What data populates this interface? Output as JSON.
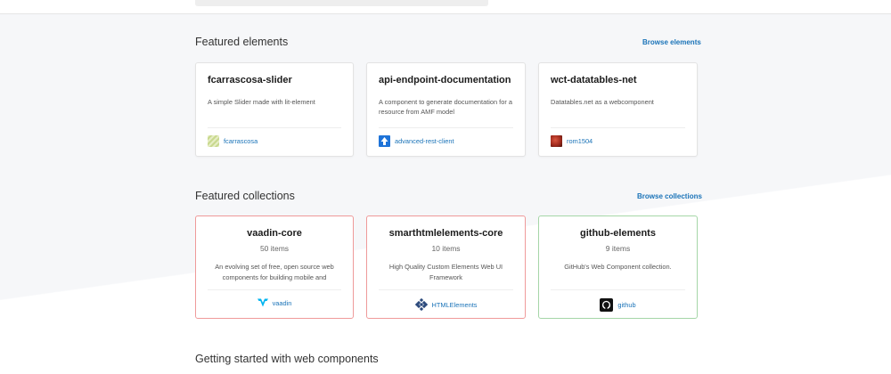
{
  "featured_elements": {
    "title": "Featured elements",
    "browse_label": "Browse elements",
    "cards": [
      {
        "name": "fcarrascosa-slider",
        "description": "A simple Slider made with lit-element",
        "owner": "fcarrascosa",
        "avatar_color": "#c9d98f"
      },
      {
        "name": "api-endpoint-documentation",
        "description": "A component to generate documentation for a resource from AMF model",
        "owner": "advanced-rest-client",
        "avatar_color": "#1e73d8"
      },
      {
        "name": "wct-datatables-net",
        "description": "Datatables.net as a webcomponent",
        "owner": "rom1504",
        "avatar_color": "#a02a1c"
      }
    ]
  },
  "featured_collections": {
    "title": "Featured collections",
    "browse_label": "Browse collections",
    "cards": [
      {
        "name": "vaadin-core",
        "count": "50 items",
        "description": "An evolving set of free, open source web components for building mobile and",
        "owner": "vaadin",
        "border_color": "#ef9a9a"
      },
      {
        "name": "smarthtmlelements-core",
        "count": "10 items",
        "description": "High Quality Custom Elements Web UI Framework",
        "owner": "HTMLElements",
        "border_color": "#ef9a9a"
      },
      {
        "name": "github-elements",
        "count": "9 items",
        "description": "GitHub's Web Component collection.",
        "owner": "github",
        "border_color": "#a5d6a7"
      }
    ]
  },
  "getting_started": {
    "title": "Getting started with web components"
  },
  "colors": {
    "link": "#1a73b8",
    "background": "#f6f7f9"
  }
}
